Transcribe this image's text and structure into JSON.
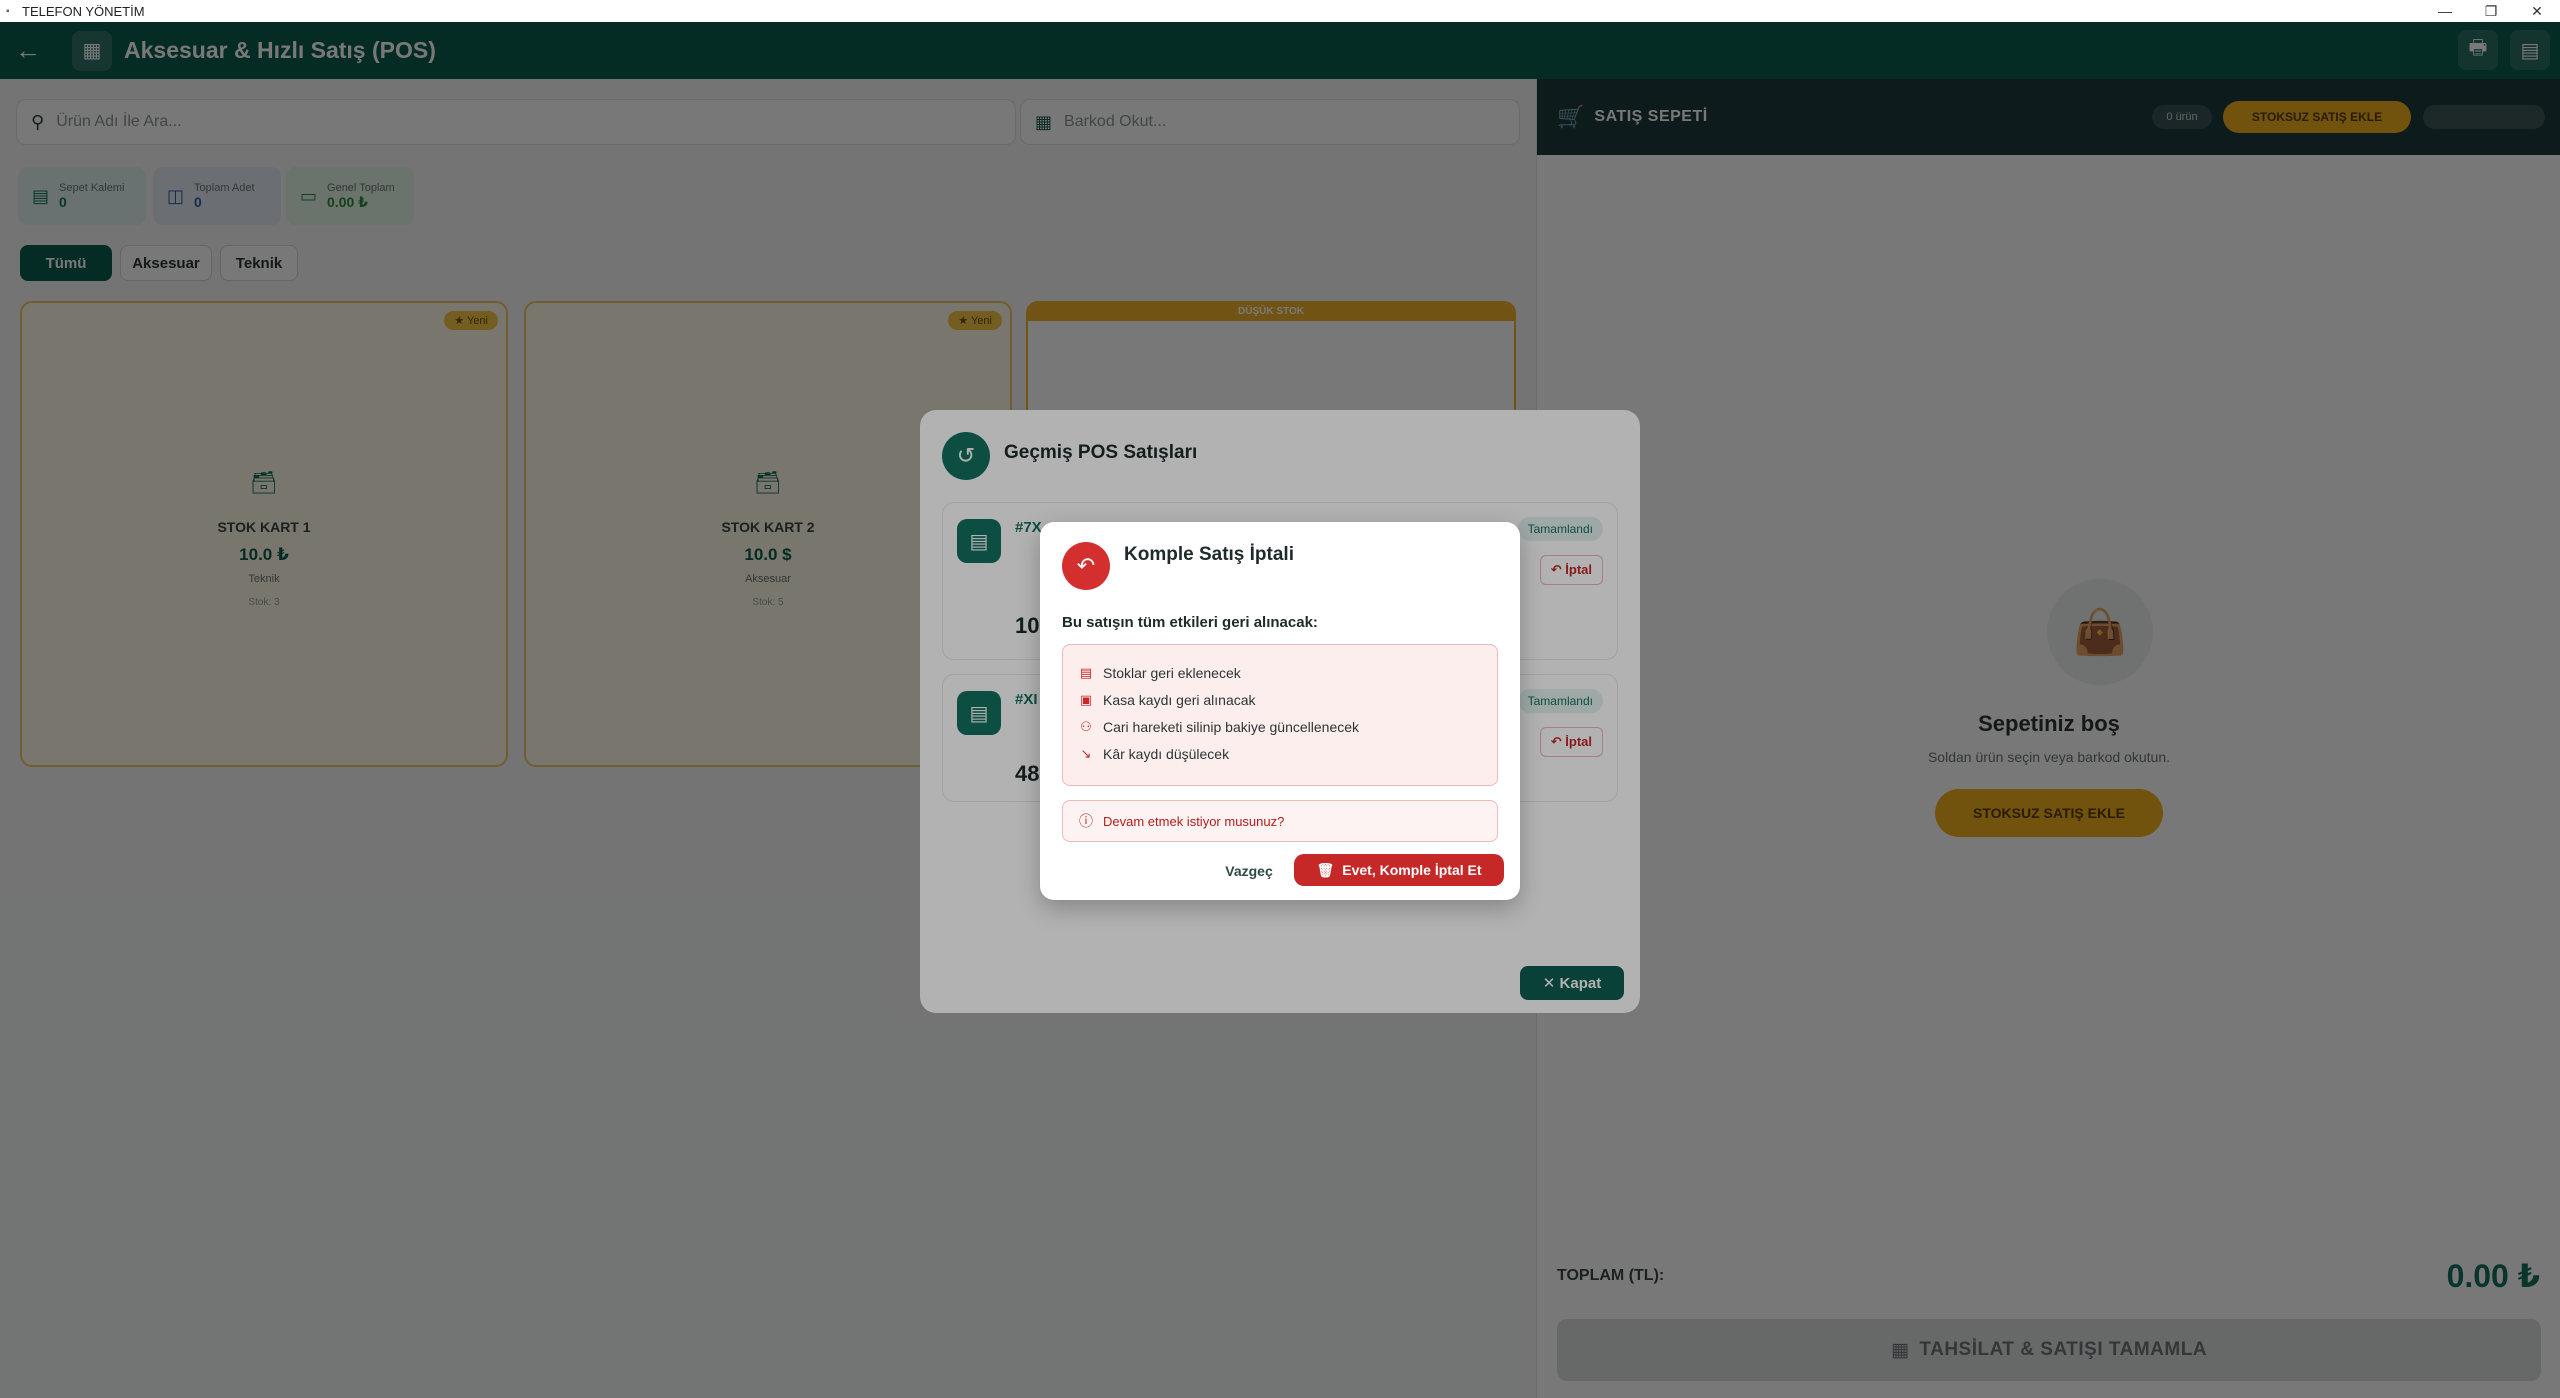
{
  "window": {
    "title": "TELEFON YÖNETİM",
    "controls": {
      "minimize": "—",
      "restore": "❐",
      "close": "✕"
    }
  },
  "appbar": {
    "back_icon": "←",
    "title": "Aksesuar & Hızlı Satış (POS)",
    "print_icon": "🖶",
    "receipt_icon": "▤"
  },
  "search": {
    "icon": "⚲",
    "placeholder": "Ürün Adı İle Ara..."
  },
  "barcode": {
    "icon": "▦",
    "placeholder": "Barkod Okut..."
  },
  "stats": [
    {
      "label": "Sepet Kalemi",
      "value": "0",
      "icon": "▤"
    },
    {
      "label": "Toplam Adet",
      "value": "0",
      "icon": "◫"
    },
    {
      "label": "Genel Toplam",
      "value": "0.00 ₺",
      "icon": "▭"
    }
  ],
  "filters": [
    "Tümü",
    "Aksesuar",
    "Teknik"
  ],
  "products": [
    {
      "name": "STOK KART 1",
      "price": "10.0 ₺",
      "category": "Teknik",
      "stock": "Stok: 3",
      "badge": "★ Yeni"
    },
    {
      "name": "STOK KART 2",
      "price": "10.0 $",
      "category": "Aksesuar",
      "stock": "Stok: 5",
      "badge": "★ Yeni"
    },
    {
      "low_stock": "DÜŞÜK STOK"
    }
  ],
  "cart": {
    "icon": "🛒",
    "title": "SATIŞ SEPETİ",
    "count": "0 ürün",
    "no_stock_button": "STOKSUZ SATIŞ EKLE",
    "empty_title": "Sepetiniz boş",
    "empty_subtitle": "Soldan ürün seçin veya barkod okutun.",
    "empty_button": "STOKSUZ SATIŞ EKLE",
    "total_label": "TOPLAM (TL):",
    "total_value": "0.00 ₺",
    "complete_button": "TAHSİLAT & SATIŞI TAMAMLA"
  },
  "history_modal": {
    "icon": "↺",
    "title": "Geçmiş POS Satışları",
    "sales": [
      {
        "code": "#7X",
        "amount": "10.",
        "status": "Tamamlandı",
        "cancel": "↶ İptal"
      },
      {
        "code": "#XI",
        "amount": "48",
        "status": "Tamamlandı",
        "cancel": "↶ İptal"
      }
    ],
    "close_button": "✕  Kapat"
  },
  "confirm_dialog": {
    "icon": "↶",
    "title": "Komple Satış İptali",
    "description": "Bu satışın tüm etkileri geri alınacak:",
    "items": [
      {
        "icon": "▤",
        "text": "Stoklar geri eklenecek"
      },
      {
        "icon": "▣",
        "text": "Kasa kaydı geri alınacak"
      },
      {
        "icon": "⚇",
        "text": "Cari hareketi silinip bakiye güncellenecek"
      },
      {
        "icon": "↘",
        "text": "Kâr kaydı düşülecek"
      }
    ],
    "warning_icon": "ⓘ",
    "warning": "Devam etmek istiyor musunuz?",
    "cancel_button": "Vazgeç",
    "confirm_icon": "🗑",
    "confirm_button": "Evet, Komple İptal Et"
  },
  "colors": {
    "primary": "#0d5c50",
    "danger": "#c62828",
    "warning": "#f2b01e",
    "cart_header": "#1d3a3d"
  }
}
